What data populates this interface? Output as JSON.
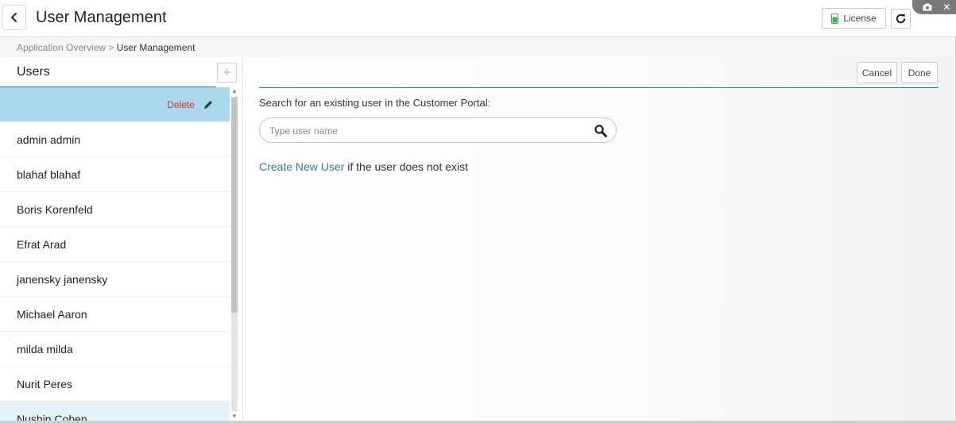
{
  "header": {
    "title": "User Management",
    "license_label": "License",
    "license_icon_color": "#3fae49"
  },
  "breadcrumb": {
    "parent": "Application Overview",
    "separator": ">",
    "current": "User Management"
  },
  "users_panel": {
    "title": "Users",
    "selected_row": {
      "delete_label": "Delete"
    },
    "items": [
      {
        "label": "admin admin"
      },
      {
        "label": "blahaf blahaf"
      },
      {
        "label": "Boris Korenfeld"
      },
      {
        "label": "Efrat Arad"
      },
      {
        "label": "janensky janensky"
      },
      {
        "label": "Michael Aaron"
      },
      {
        "label": "milda milda"
      },
      {
        "label": "Nurit Peres"
      },
      {
        "label": "Nushin Cohen"
      }
    ]
  },
  "editor": {
    "cancel_label": "Cancel",
    "done_label": "Done",
    "search_label": "Search for an existing user in the Customer Portal:",
    "search_placeholder": "Type user name",
    "search_value": "",
    "create_link": "Create New User",
    "create_suffix": "if the user does not exist"
  },
  "colors": {
    "accent": "#2c7bb6",
    "selected_row": "#abd8ec",
    "hover_row": "#e2f3f9",
    "danger": "#d9302a"
  }
}
